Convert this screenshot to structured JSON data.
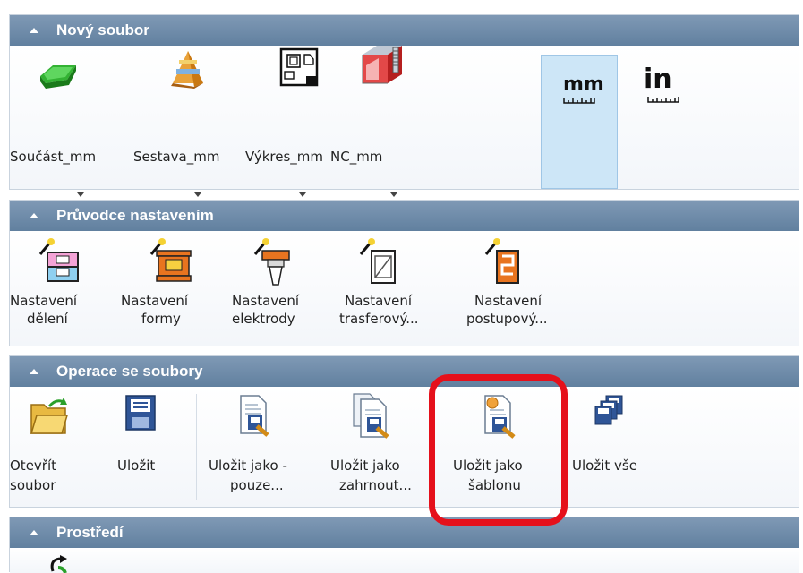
{
  "sections": {
    "new_file": {
      "title": "Nový soubor",
      "items": [
        "Součást_mm",
        "Sestava_mm",
        "Výkres_mm",
        "NC_mm"
      ],
      "units": [
        "mm",
        "in"
      ]
    },
    "wizard": {
      "title": "Průvodce nastavením",
      "items": [
        {
          "line1": "Nastavení",
          "line2": "dělení"
        },
        {
          "line1": "Nastavení",
          "line2": "formy"
        },
        {
          "line1": "Nastavení",
          "line2": "elektrody"
        },
        {
          "line1": "Nastavení",
          "line2": "trasferový..."
        },
        {
          "line1": "Nastavení",
          "line2": "postupový..."
        }
      ]
    },
    "file_ops": {
      "title": "Operace se soubory",
      "items": [
        {
          "line1": "Otevřít",
          "line2": "soubor"
        },
        {
          "line1": "Uložit",
          "line2": ""
        },
        {
          "line1": "Uložit jako -",
          "line2": "pouze..."
        },
        {
          "line1": "Uložit jako",
          "line2": "zahrnout..."
        },
        {
          "line1": "Uložit jako",
          "line2": "šablonu"
        },
        {
          "line1": "Uložit vše",
          "line2": ""
        }
      ]
    },
    "environment": {
      "title": "Prostředí"
    }
  },
  "colors": {
    "header": "#6b88a7",
    "highlight": "#e5101b",
    "selected": "#cde6f7"
  }
}
